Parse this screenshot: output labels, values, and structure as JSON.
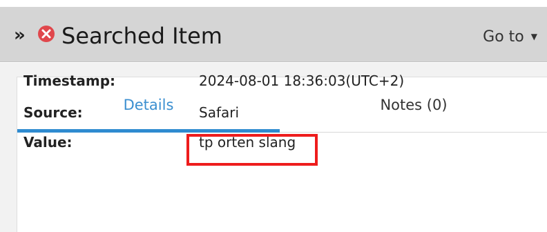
{
  "header": {
    "expand_glyph": "»",
    "title": "Searched Item",
    "goto_label": "Go to",
    "goto_caret": "▼",
    "close_icon": "close-circle-icon",
    "close_color": "#e0474c"
  },
  "tabs": [
    {
      "label": "Details",
      "active": true
    },
    {
      "label": "Notes (0)",
      "active": false
    }
  ],
  "details": {
    "timestamp_label": "Timestamp:",
    "timestamp_value": "2024-08-01 18:36:03(UTC+2)",
    "source_label": "Source:",
    "source_value": "Safari",
    "value_label": "Value:",
    "value_value": "tp orten slang"
  },
  "colors": {
    "accent": "#2f8bd0",
    "header_bg": "#d5d5d5",
    "highlight": "#ee1c1c"
  }
}
